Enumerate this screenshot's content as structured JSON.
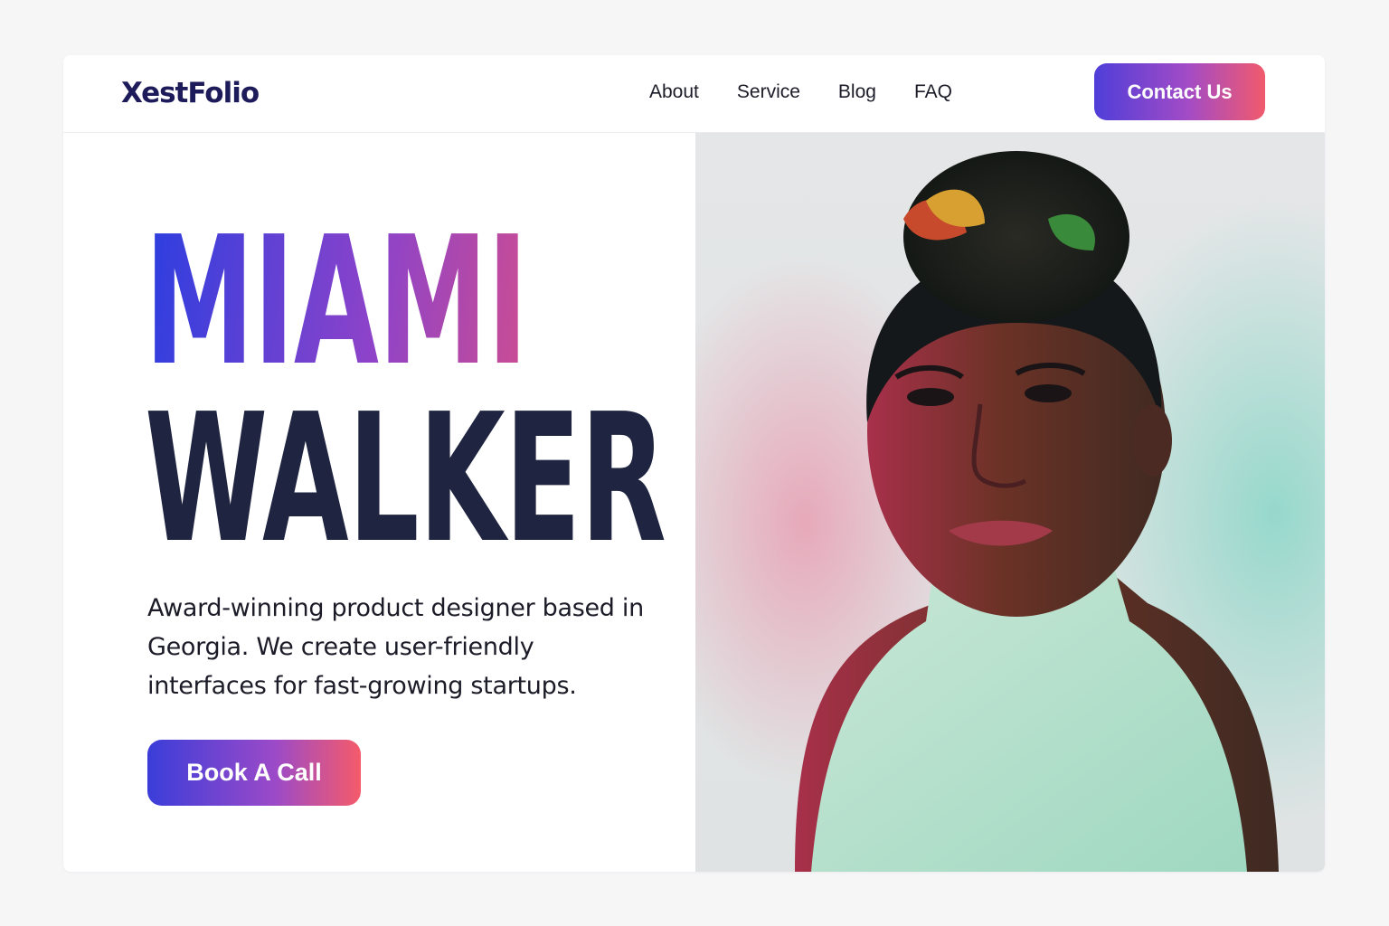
{
  "brand": {
    "logo": "XestFolio"
  },
  "nav": {
    "items": [
      {
        "label": "About"
      },
      {
        "label": "Service"
      },
      {
        "label": "Blog"
      },
      {
        "label": "FAQ"
      }
    ],
    "cta_label": "Contact Us"
  },
  "hero": {
    "first_name": "MIAMI",
    "last_name": "WALKER",
    "bio": "Award-winning product designer based in Georgia. We create user-friendly interfaces for fast-growing startups.",
    "cta_label": "Book A Call"
  },
  "colors": {
    "gradient_start": "#3a3dd9",
    "gradient_end": "#f55b6a",
    "heading_dark": "#1f2440",
    "logo": "#1e1b5a"
  }
}
